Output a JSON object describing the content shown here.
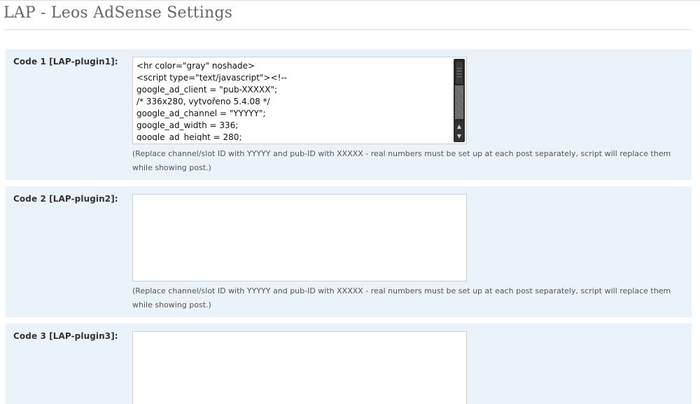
{
  "page": {
    "title": "LAP - Leos AdSense Settings"
  },
  "fields": [
    {
      "label": "Code 1 [LAP-plugin1]:",
      "value": "<hr color=\"gray\" noshade>\n<script type=\"text/javascript\"><!--\ngoogle_ad_client = \"pub-XXXXX\";\n/* 336x280, vytvořeno 5.4.08 */\ngoogle_ad_channel = \"YYYYY\";\ngoogle_ad_width = 336;\ngoogle_ad_height = 280;",
      "hint": "(Replace channel/slot ID with YYYYY and pub-ID with XXXXX - real numbers must be set up at each post separately, script will replace them while showing post.)"
    },
    {
      "label": "Code 2 [LAP-plugin2]:",
      "value": "",
      "hint": "(Replace channel/slot ID with YYYYY and pub-ID with XXXXX - real numbers must be set up at each post separately, script will replace them while showing post.)"
    },
    {
      "label": "Code 3 [LAP-plugin3]:",
      "value": "",
      "hint": ""
    }
  ],
  "icons": {
    "scroll_up": "▲",
    "scroll_down": "▼"
  },
  "colors": {
    "row_background": "#eaf2fa",
    "title": "#666666",
    "field_border": "#c8d0d8"
  }
}
